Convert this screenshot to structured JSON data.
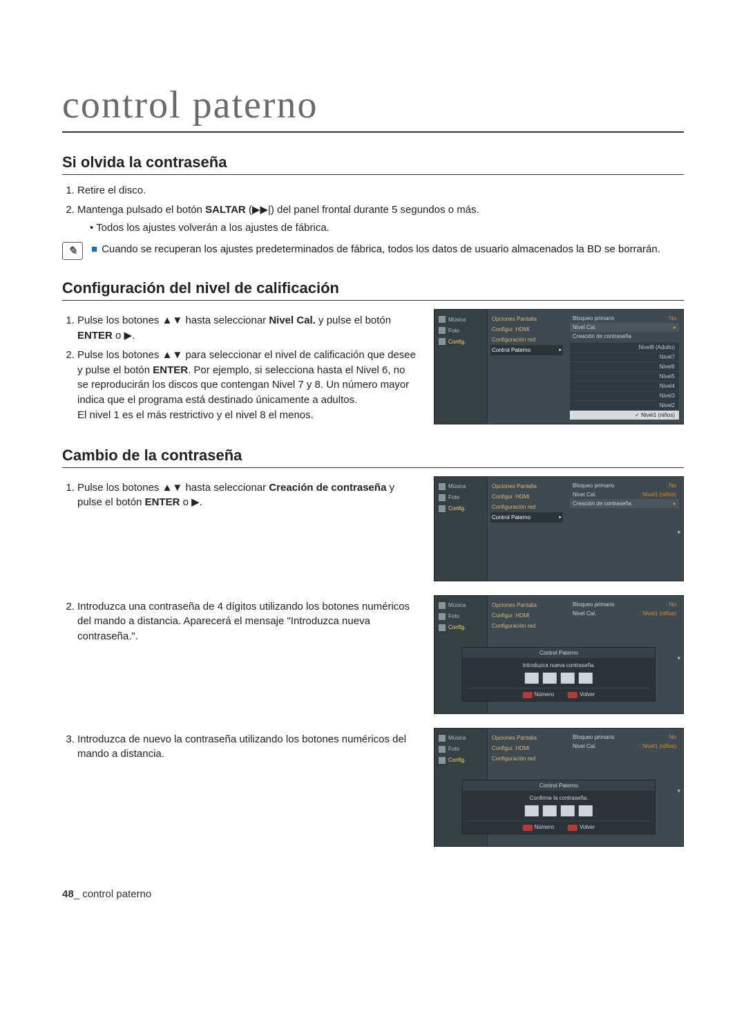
{
  "page_title": "control paterno",
  "section1": {
    "title": "Si olvida la contraseña",
    "step1": "Retire el disco.",
    "step2_a": "Mantenga pulsado el botón ",
    "step2_b": "SALTAR",
    "step2_c": " (▶▶|) del panel frontal durante 5 segundos o más.",
    "step2_sub": "• Todos los ajustes volverán a los ajustes de fábrica.",
    "note": "Cuando se recuperan los ajustes predeterminados de fábrica, todos los datos de usuario almacenados la BD se borrarán."
  },
  "section2": {
    "title": "Configuración del nivel de calificación",
    "step1_a": "Pulse los botones ▲▼ hasta seleccionar ",
    "step1_b": "Nivel Cal.",
    "step1_c": " y pulse el botón ",
    "step1_d": "ENTER",
    "step1_e": " o ▶.",
    "step2_a": "Pulse los botones ▲▼ para seleccionar el nivel de calificación que desee y pulse el botón ",
    "step2_b": "ENTER",
    "step2_c": ". Por ejemplo, si selecciona hasta el Nivel 6, no se reproducirán los discos que contengan Nivel 7 y 8. Un número mayor indica que el programa está destinado únicamente a adultos.",
    "step2_tail": "El nivel 1 es el más restrictivo y el nivel 8 el menos."
  },
  "section3": {
    "title": "Cambio de la contraseña",
    "step1_a": "Pulse los botones ▲▼ hasta seleccionar ",
    "step1_b": "Creación de contraseña",
    "step1_c": " y pulse el botón ",
    "step1_d": "ENTER",
    "step1_e": " o ▶.",
    "step2": "Introduzca una contraseña de 4 dígitos utilizando los botones numéricos del mando a distancia. Aparecerá el mensaje \"Introduzca nueva contraseña.\".",
    "step3": "Introduzca de nuevo la contraseña utilizando los botones numéricos del mando a distancia."
  },
  "shot_common": {
    "side": {
      "musica": "Música",
      "foto": "Foto",
      "config": "Config."
    },
    "col1": {
      "opciones_pantalla": "Opciones Pantalla",
      "configur_hdmi": "Configur. HDMI",
      "configuracion_red": "Configuración red",
      "control_paterno": "Control Paterno"
    },
    "col2_keys": {
      "bloqueo": "Bloqueo primario",
      "nivel": "Nivel Cal.",
      "creacion": "Creación de contraseña"
    },
    "col2_vals": {
      "no": "No",
      "nivel1": "Nivel1 (niños)"
    }
  },
  "shot1": {
    "options": [
      "Nivel8 (Adulto)",
      "Nivel7",
      "Nivel6",
      "Nivel5",
      "Nivel4",
      "Nivel3",
      "Nivel2",
      "Nivel1 (niños)"
    ]
  },
  "shot_modal": {
    "header": "Control Paterno",
    "prompt_new": "Introduzca nueva contraseña.",
    "prompt_confirm": "Confirme la contraseña.",
    "btn_numero": "Número",
    "btn_volver": "Volver"
  },
  "footer": {
    "page_num": "48",
    "label": "control paterno"
  }
}
